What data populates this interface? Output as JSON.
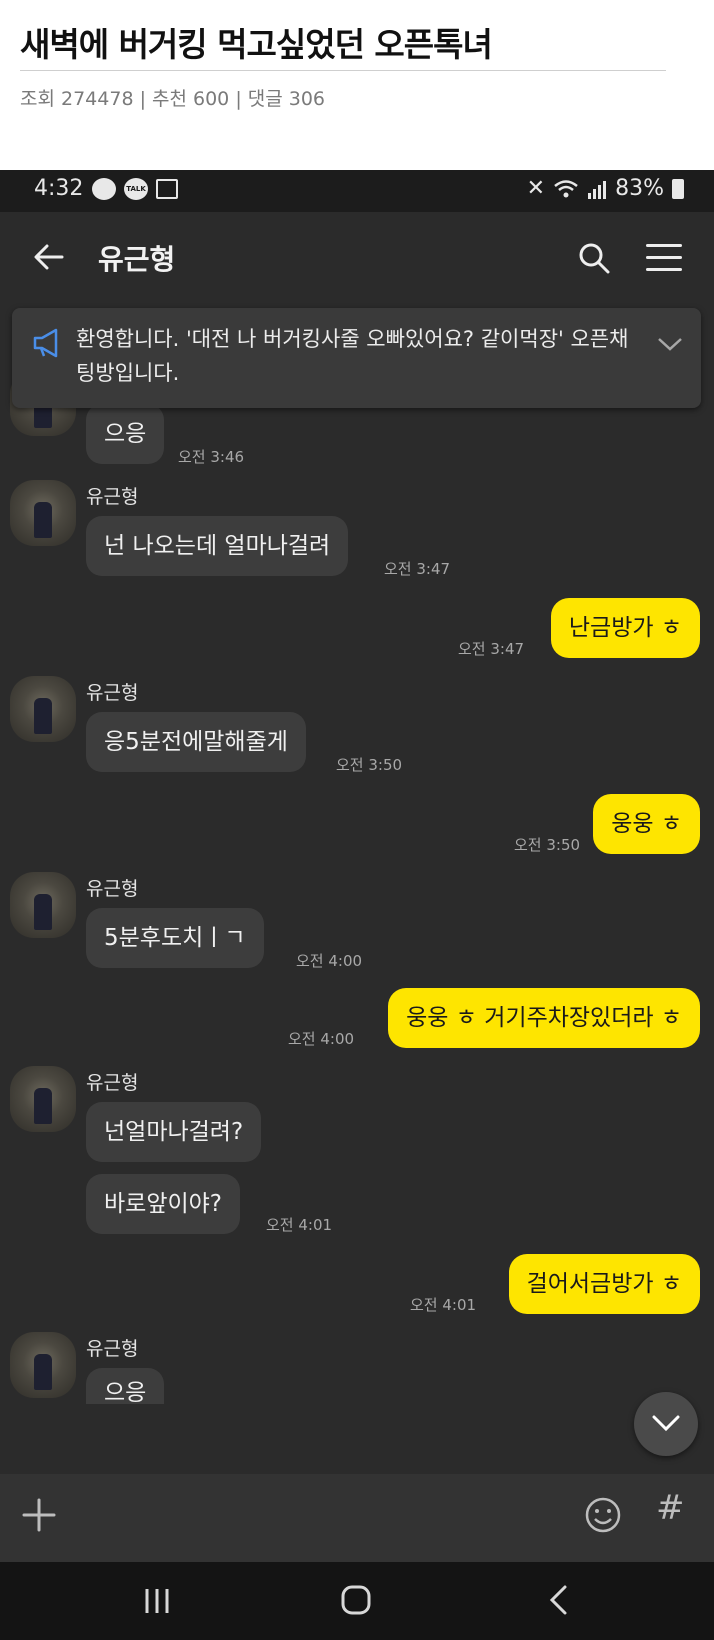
{
  "post": {
    "title": "새벽에 버거킹 먹고싶었던 오픈톡녀",
    "meta": "조회 274478 | 추천 600 | 댓글 306"
  },
  "status_bar": {
    "time": "4:32",
    "talk_badge": "TALK",
    "battery": "83%"
  },
  "chat": {
    "title": "유근형",
    "notice": "환영합니다. '대전 나 버거킹사줄 오빠있어요? 같이먹장' 오픈채팅방입니다."
  },
  "messages": [
    {
      "side": "in",
      "sender": "",
      "text": "으응",
      "time": "오전 3:46"
    },
    {
      "side": "in",
      "sender": "유근형",
      "text": "넌 나오는데 얼마나걸려",
      "time": "오전 3:47"
    },
    {
      "side": "out",
      "text": "난금방가 ㅎ",
      "time": "오전 3:47"
    },
    {
      "side": "in",
      "sender": "유근형",
      "text": "응5분전에말해줄게",
      "time": "오전 3:50"
    },
    {
      "side": "out",
      "text": "웅웅 ㅎ",
      "time": "오전 3:50"
    },
    {
      "side": "in",
      "sender": "유근형",
      "text": "5분후도치ㅣㄱ",
      "time": "오전 4:00"
    },
    {
      "side": "out",
      "text": "웅웅 ㅎ 거기주차장있더라 ㅎ",
      "time": "오전 4:00"
    },
    {
      "side": "in",
      "sender": "유근형",
      "text": "넌얼마나걸려?",
      "time": ""
    },
    {
      "side": "in",
      "sender": "",
      "text": "바로앞이야?",
      "time": "오전 4:01"
    },
    {
      "side": "out",
      "text": "걸어서금방가 ㅎ",
      "time": "오전 4:01"
    },
    {
      "side": "in",
      "sender": "유근형",
      "text": "으응",
      "time": ""
    }
  ],
  "input_bar": {
    "hash_label": "#"
  },
  "colors": {
    "bubble_out": "#fee500",
    "bubble_in": "#3d3d3d",
    "background": "#2b2b2b"
  }
}
